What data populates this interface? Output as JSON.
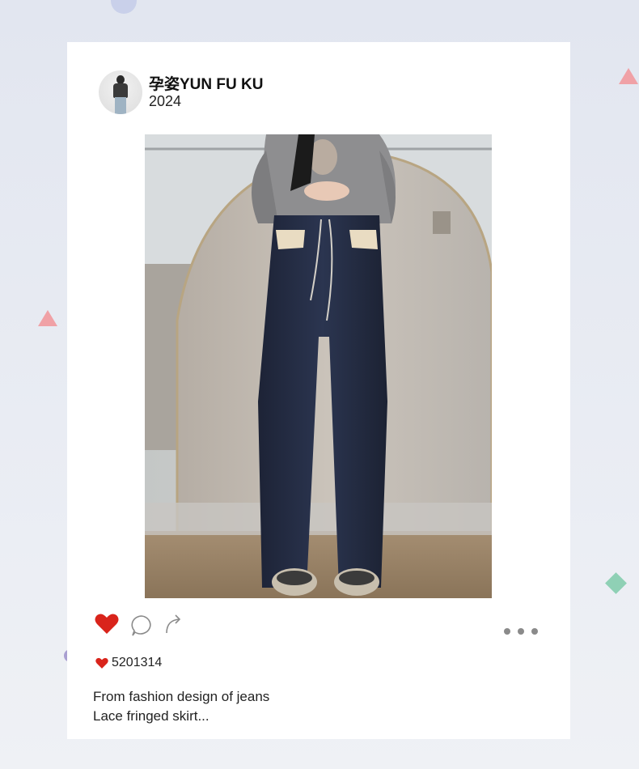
{
  "post": {
    "author": "孕姿YUN FU KU",
    "year": "2024",
    "likes": "5201314",
    "caption_line1": "From fashion design of jeans",
    "caption_line2": "Lace fringed skirt..."
  },
  "icons": {
    "like": "heart-icon",
    "comment": "comment-bubble-icon",
    "share": "share-arrow-icon",
    "more": "more-dots-icon",
    "likes_marker": "small-heart-icon"
  },
  "colors": {
    "heart": "#d9241b",
    "card": "#ffffff",
    "background": "#e2e6f0",
    "deco_pink": "#f0a1a6",
    "deco_green": "#8fd0b5"
  }
}
